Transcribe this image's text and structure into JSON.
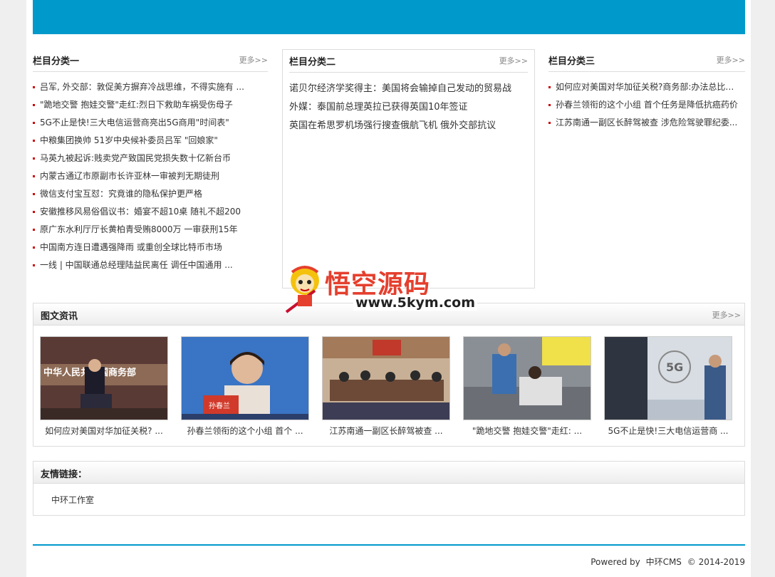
{
  "colors": {
    "banner": "#0099cc",
    "accent_dot": "#cc0000",
    "footer_line": "#0099cc"
  },
  "col1": {
    "title": "栏目分类一",
    "more": "更多>>",
    "items": [
      "吕军, 外交部：敦促美方摒弃冷战思维，不得实施有 ...",
      "\"跪地交警 抱娃交警\"走红:烈日下救助车祸受伤母子",
      "5G不止是快!三大电信运营商亮出5G商用\"时间表\"",
      "中粮集团换帅 51岁中央候补委员吕军 \"回娘家\"",
      "马英九被起诉:贱卖党产致国民党损失数十亿新台币",
      "内蒙古通辽市原副市长许亚林一审被判无期徒刑",
      "微信支付宝互怼：究竟谁的隐私保护更严格",
      "安徽推移风易俗倡议书：婚宴不超10桌 随礼不超200",
      "原广东水利厅厅长黄柏青受贿8000万 一审获刑15年",
      "中国南方连日遭遇强降雨 或重创全球比特币市场",
      "一线 | 中国联通总经理陆益民离任 调任中国通用 ..."
    ]
  },
  "col2": {
    "title": "栏目分类二",
    "more": "更多>>",
    "items": [
      "诺贝尔经济学奖得主：美国将会输掉自己发动的贸易战",
      "外媒：泰国前总理英拉已获得英国10年签证",
      "英国在希思罗机场强行搜查俄航飞机 俄外交部抗议"
    ]
  },
  "col3": {
    "title": "栏目分类三",
    "more": "更多>>",
    "items": [
      "如何应对美国对华加征关税?商务部:办法总比困...",
      "孙春兰领衔的这个小组 首个任务是降低抗癌药价",
      "江苏南通一副区长醉驾被查 涉危险驾驶罪纪委..."
    ]
  },
  "photo": {
    "title": "图文资讯",
    "more": "更多>>",
    "items": [
      {
        "caption": "如何应对美国对华加征关税? ...",
        "image_text": "中华人民共和国商务部"
      },
      {
        "caption": "孙春兰领衔的这个小组 首个 ...",
        "image_text": "孙春兰"
      },
      {
        "caption": "江苏南通一副区长醉驾被查 ..."
      },
      {
        "caption": "\"跪地交警 抱娃交警\"走红: ..."
      },
      {
        "caption": "5G不止是快!三大电信运营商 ...",
        "image_text": "5G"
      }
    ]
  },
  "links": {
    "title": "友情链接：",
    "items": [
      "中环工作室"
    ]
  },
  "footer": {
    "powered": "Powered by",
    "cms": "中环CMS",
    "copyright": "© 2014-2019"
  },
  "watermark": {
    "title": "悟空源码",
    "url": "www.5kym.com"
  }
}
